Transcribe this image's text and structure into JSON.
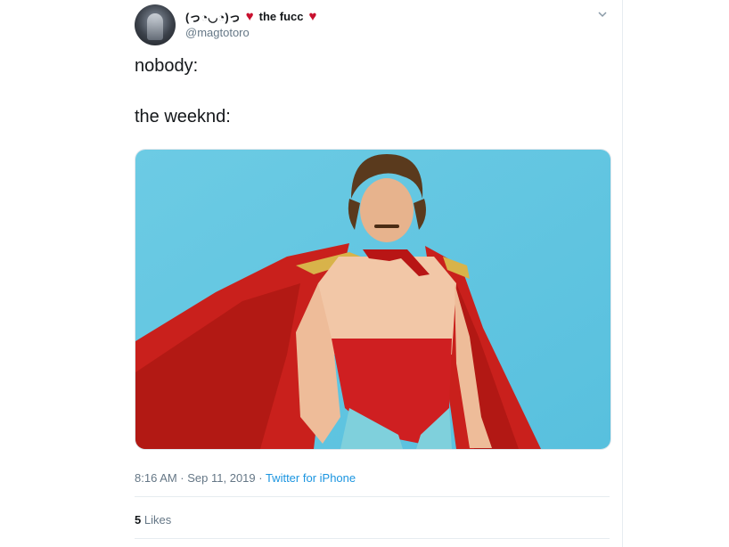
{
  "tweet": {
    "display_name": "(っ◔◡◔)っ",
    "display_name_suffix": "the fucc",
    "handle": "@magtotoro",
    "lines": [
      "nobody:",
      "the weeknd:"
    ],
    "timestamp": "8:16 AM · Sep 11, 2019 · ",
    "source": "Twitter for iPhone",
    "likes_count": "5",
    "likes_label": " Likes"
  },
  "icons": [
    "heart-icon",
    "chevron-down-icon"
  ],
  "colors": {
    "accent": "#1b95e0",
    "heart": "#c8102e",
    "muted": "#657786",
    "media_bg": "#64c7e2"
  }
}
